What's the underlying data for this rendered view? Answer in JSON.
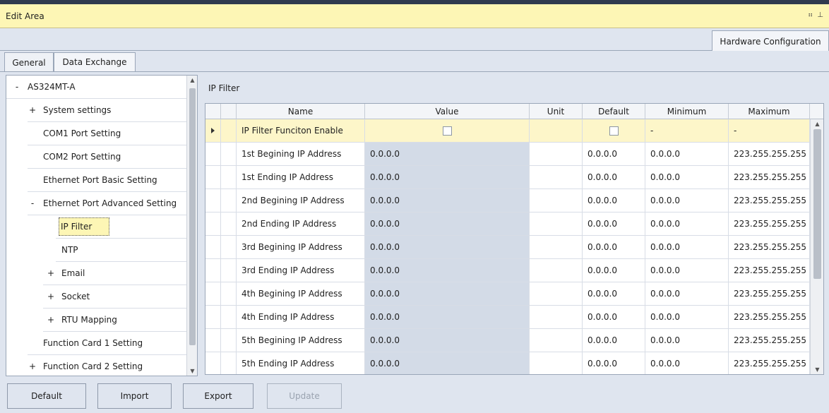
{
  "window": {
    "title": "Edit Area"
  },
  "doc_tab": {
    "label": "Hardware Configuration"
  },
  "tabs": [
    {
      "label": "General"
    },
    {
      "label": "Data Exchange"
    }
  ],
  "tree": {
    "items": [
      {
        "toggle": "-",
        "label": "AS324MT-A"
      },
      {
        "toggle": "+",
        "label": "System settings"
      },
      {
        "toggle": "",
        "label": "COM1 Port Setting"
      },
      {
        "toggle": "",
        "label": "COM2 Port Setting"
      },
      {
        "toggle": "",
        "label": "Ethernet Port Basic Setting"
      },
      {
        "toggle": "-",
        "label": "Ethernet Port Advanced Setting"
      },
      {
        "toggle": "",
        "label": "IP Filter"
      },
      {
        "toggle": "",
        "label": "NTP"
      },
      {
        "toggle": "+",
        "label": "Email"
      },
      {
        "toggle": "+",
        "label": "Socket"
      },
      {
        "toggle": "+",
        "label": "RTU Mapping"
      },
      {
        "toggle": "",
        "label": "Function Card 1 Setting"
      },
      {
        "toggle": "+",
        "label": "Function Card 2 Setting"
      }
    ]
  },
  "panel": {
    "title": "IP Filter"
  },
  "grid": {
    "columns": [
      "Name",
      "Value",
      "Unit",
      "Default",
      "Minimum",
      "Maximum"
    ],
    "first_row": {
      "name": "IP Filter Funciton Enable",
      "min": "-",
      "max": "-"
    },
    "rows": [
      {
        "name": "1st Begining IP Address",
        "value": "0.0.0.0",
        "unit": "",
        "default": "0.0.0.0",
        "min": "0.0.0.0",
        "max": "223.255.255.255"
      },
      {
        "name": "1st Ending IP Address",
        "value": "0.0.0.0",
        "unit": "",
        "default": "0.0.0.0",
        "min": "0.0.0.0",
        "max": "223.255.255.255"
      },
      {
        "name": "2nd Begining IP Address",
        "value": "0.0.0.0",
        "unit": "",
        "default": "0.0.0.0",
        "min": "0.0.0.0",
        "max": "223.255.255.255"
      },
      {
        "name": "2nd Ending IP Address",
        "value": "0.0.0.0",
        "unit": "",
        "default": "0.0.0.0",
        "min": "0.0.0.0",
        "max": "223.255.255.255"
      },
      {
        "name": "3rd Begining IP Address",
        "value": "0.0.0.0",
        "unit": "",
        "default": "0.0.0.0",
        "min": "0.0.0.0",
        "max": "223.255.255.255"
      },
      {
        "name": "3rd Ending IP Address",
        "value": "0.0.0.0",
        "unit": "",
        "default": "0.0.0.0",
        "min": "0.0.0.0",
        "max": "223.255.255.255"
      },
      {
        "name": "4th Begining IP Address",
        "value": "0.0.0.0",
        "unit": "",
        "default": "0.0.0.0",
        "min": "0.0.0.0",
        "max": "223.255.255.255"
      },
      {
        "name": "4th Ending IP Address",
        "value": "0.0.0.0",
        "unit": "",
        "default": "0.0.0.0",
        "min": "0.0.0.0",
        "max": "223.255.255.255"
      },
      {
        "name": "5th Begining IP Address",
        "value": "0.0.0.0",
        "unit": "",
        "default": "0.0.0.0",
        "min": "0.0.0.0",
        "max": "223.255.255.255"
      },
      {
        "name": "5th Ending IP Address",
        "value": "0.0.0.0",
        "unit": "",
        "default": "0.0.0.0",
        "min": "0.0.0.0",
        "max": "223.255.255.255"
      }
    ]
  },
  "buttons": {
    "default": "Default",
    "import": "Import",
    "export": "Export",
    "update": "Update"
  },
  "colors": {
    "title_bar": "#fdf6b5",
    "selected_row": "#fdf6c9",
    "value_cell": "#d3dbe7",
    "panel_bg": "#dfe5ef"
  }
}
